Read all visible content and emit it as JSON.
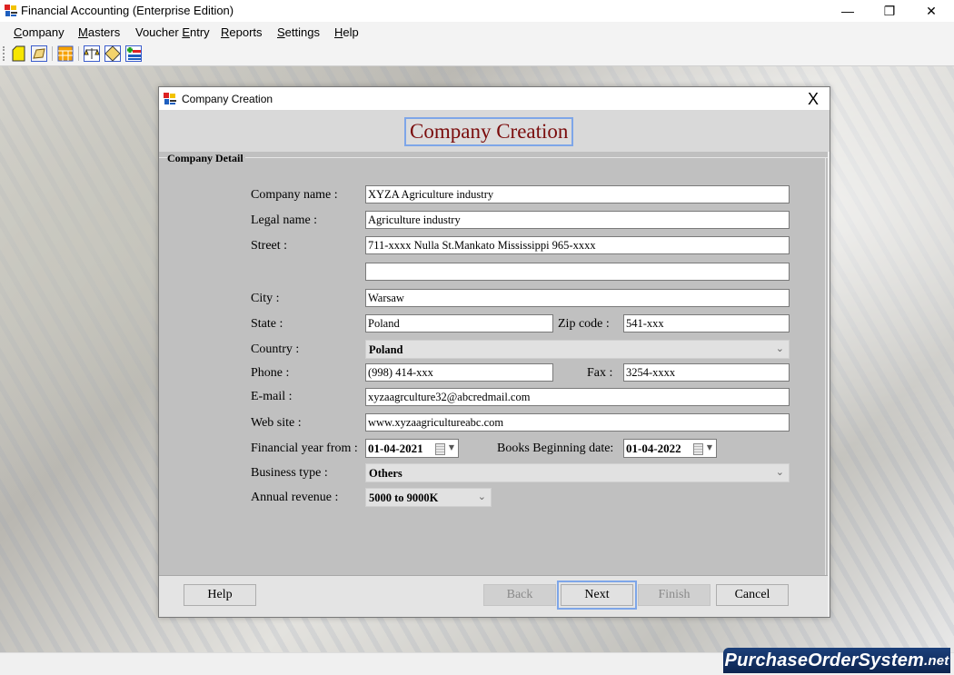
{
  "app": {
    "title": "Financial Accounting (Enterprise Edition)",
    "window_controls": {
      "minimize": "—",
      "restore": "❐",
      "close": "✕"
    }
  },
  "menu": [
    {
      "label_u": "C",
      "label_rest": "ompany"
    },
    {
      "label_u": "M",
      "label_rest": "asters"
    },
    {
      "label_pre": "Voucher ",
      "label_u": "E",
      "label_rest": "ntry"
    },
    {
      "label_u": "R",
      "label_rest": "eports"
    },
    {
      "label_u": "S",
      "label_rest": "ettings"
    },
    {
      "label_u": "H",
      "label_rest": "elp"
    }
  ],
  "toolbar": {
    "icons": [
      "new-company-icon",
      "open-company-icon",
      "ledger-grid-icon",
      "balance-scale-icon",
      "voucher-icon",
      "add-entry-icon"
    ]
  },
  "dialog": {
    "title": "Company Creation",
    "close": "X",
    "header": "Company Creation",
    "group_label": "Company Detail",
    "fields": {
      "company_name": {
        "label": "Company name :",
        "value": "XYZA Agriculture industry"
      },
      "legal_name": {
        "label": "Legal name :",
        "value": "Agriculture industry"
      },
      "street": {
        "label": "Street :",
        "value": "711-xxxx Nulla St.Mankato Mississippi 965-xxxx",
        "value2": ""
      },
      "city": {
        "label": "City :",
        "value": "Warsaw"
      },
      "state": {
        "label": "State :",
        "value": "Poland"
      },
      "zip": {
        "label": "Zip code :",
        "value": "541-xxx"
      },
      "country": {
        "label": "Country :",
        "value": "Poland"
      },
      "phone": {
        "label": "Phone :",
        "value": "(998) 414-xxx"
      },
      "fax": {
        "label": "Fax :",
        "value": "3254-xxxx"
      },
      "email": {
        "label": "E-mail :",
        "value": "xyzaagrculture32@abcredmail.com"
      },
      "website": {
        "label": "Web site :",
        "value": "www.xyzaagricultureabc.com"
      },
      "fy_from": {
        "label": "Financial year from :",
        "value": "01-04-2021"
      },
      "books_begin": {
        "label": "Books Beginning date:",
        "value": "01-04-2022"
      },
      "business_type": {
        "label": "Business type :",
        "value": "Others"
      },
      "annual_revenue": {
        "label": "Annual revenue :",
        "value": "5000 to 9000K"
      }
    },
    "buttons": {
      "help": "Help",
      "back": "Back",
      "next": "Next",
      "finish": "Finish",
      "cancel": "Cancel"
    }
  },
  "watermark": {
    "main": "PurchaseOrderSystem",
    "suffix": ".net"
  },
  "colors": {
    "header_text": "#7a0c0c",
    "focus_ring": "#7ea6e8",
    "watermark_bg": "#1b3f7a"
  }
}
